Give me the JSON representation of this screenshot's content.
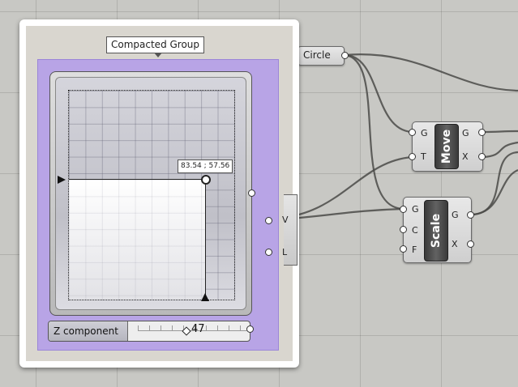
{
  "group": {
    "title": "Compacted Group"
  },
  "graph": {
    "coords": "83.54 ; 57.56"
  },
  "slider": {
    "label": "Z component",
    "value": "47"
  },
  "circle": {
    "label": "Circle"
  },
  "move": {
    "name": "Move",
    "in": [
      "G",
      "T"
    ],
    "out": [
      "G",
      "X"
    ]
  },
  "scale": {
    "name": "Scale",
    "in": [
      "G",
      "C",
      "F"
    ],
    "out": [
      "G",
      "X"
    ]
  },
  "stub": {
    "labels": [
      "V",
      "L"
    ]
  }
}
